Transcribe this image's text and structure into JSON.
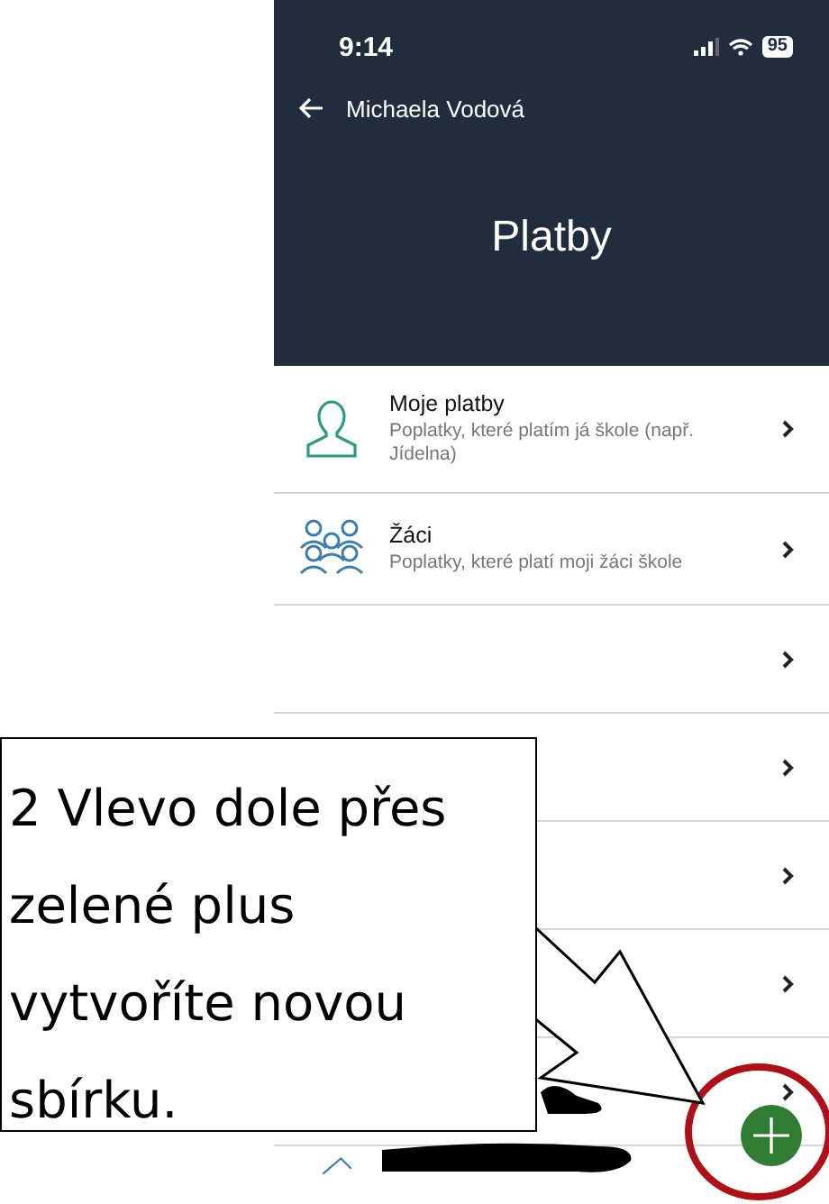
{
  "status_bar": {
    "time": "9:14",
    "battery": "95"
  },
  "header": {
    "back_label": "Michaela Vodová",
    "title": "Platby"
  },
  "items": [
    {
      "kind": "person",
      "title": "Moje platby",
      "subtitle": "Poplatky, které platím já škole (např. Jídelna)"
    },
    {
      "kind": "group",
      "title": "Žáci",
      "subtitle": "Poplatky, které platí moji žáci škole"
    },
    {
      "kind": "blank"
    },
    {
      "kind": "blank"
    },
    {
      "kind": "blank"
    },
    {
      "kind": "blank"
    },
    {
      "kind": "blank"
    },
    {
      "kind": "covered"
    }
  ],
  "callout": {
    "text": "2 Vlevo dole přes zelené plus vytvoříte novou sbírku."
  }
}
